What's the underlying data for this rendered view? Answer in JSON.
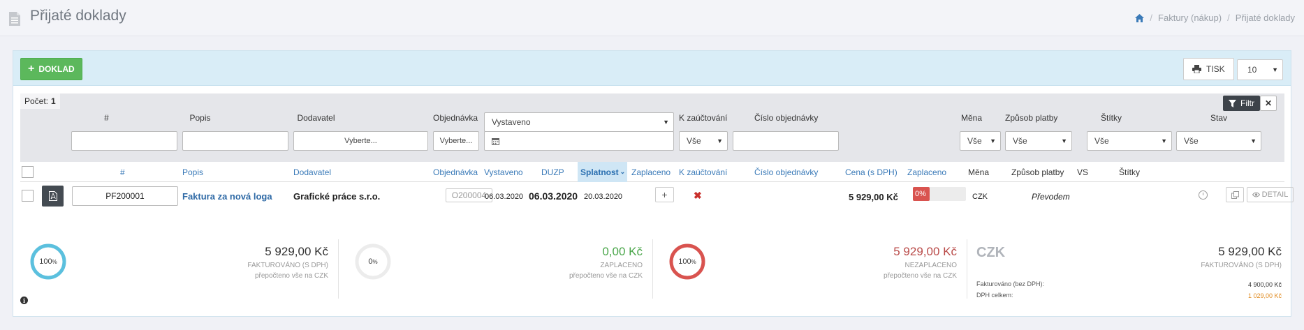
{
  "header": {
    "title": "Přijaté doklady",
    "breadcrumbs": [
      "Faktury (nákup)",
      "Přijaté doklady"
    ]
  },
  "toolbar": {
    "add_label": "DOKLAD",
    "print_label": "TISK",
    "page_size": "10"
  },
  "filters": {
    "count_label": "Počet:",
    "count_value": "1",
    "filter_label": "Filtr",
    "headers": {
      "num": "#",
      "popis": "Popis",
      "dodavatel": "Dodavatel",
      "objednavka": "Objednávka",
      "k_zauctovani": "K zaúčtování",
      "cislo_obj": "Číslo objednávky",
      "mena": "Měna",
      "zpusob_platby": "Způsob platby",
      "stitky": "Štítky",
      "stav": "Stav"
    },
    "date_select": "Vystaveno",
    "dodavatel_placeholder": "Vyberte...",
    "objednavka_placeholder": "Vyberte...",
    "k_zauctovani": "Vše",
    "mena": "Vše",
    "zpusob_platby": "Vše",
    "stitky": "Vše",
    "stav": "Vše"
  },
  "columns": {
    "num": "#",
    "popis": "Popis",
    "dodavatel": "Dodavatel",
    "objednavka": "Objednávka",
    "vystaveno": "Vystaveno",
    "duzp": "DUZP",
    "splatnost": "Splatnost",
    "zaplaceno": "Zaplaceno",
    "k_zauctovani": "K zaúčtování",
    "cislo_obj": "Číslo objednávky",
    "cena": "Cena (s DPH)",
    "zaplaceno2": "Zaplaceno",
    "mena": "Měna",
    "zpusob_platby": "Způsob platby",
    "vs": "VS",
    "stitky": "Štítky"
  },
  "rows": [
    {
      "number": "PF200001",
      "popis": "Faktura za nová loga",
      "dodavatel": "Grafické práce s.r.o.",
      "objednavka": "O200004",
      "vystaveno": "06.03.2020",
      "duzp": "06.03.2020",
      "splatnost": "20.03.2020",
      "cena": "5 929,00 Kč",
      "paid_percent": "0%",
      "paid_fraction": 0,
      "mena": "CZK",
      "zpusob_platby": "Převodem",
      "detail_label": "DETAIL"
    }
  ],
  "summary": {
    "invoiced": {
      "percent": "100",
      "percent_sign": "%",
      "amount": "5 929,00 Kč",
      "label": "FAKTUROVÁNO (S DPH)",
      "note": "přepočteno vše na CZK"
    },
    "paid": {
      "percent": "0",
      "percent_sign": "%",
      "amount": "0,00 Kč",
      "label": "ZAPLACENO",
      "note": "přepočteno vše na CZK"
    },
    "unpaid": {
      "percent": "100",
      "percent_sign": "%",
      "amount": "5 929,00 Kč",
      "label": "NEZAPLACENO",
      "note": "přepočteno vše na CZK"
    },
    "currency": {
      "code": "CZK",
      "amount": "5 929,00 Kč",
      "label": "FAKTUROVÁNO (S DPH)",
      "no_vat_label": "Fakturováno (bez DPH):",
      "no_vat_value": "4 900,00 Kč",
      "vat_label": "DPH celkem:",
      "vat_value": "1 029,00 Kč"
    }
  },
  "colors": {
    "accent_blue": "#3a7ab8",
    "success": "#5cb85c",
    "danger": "#d9534f",
    "ring_invoiced": "#5bc0de",
    "ring_unpaid": "#d9534f"
  }
}
